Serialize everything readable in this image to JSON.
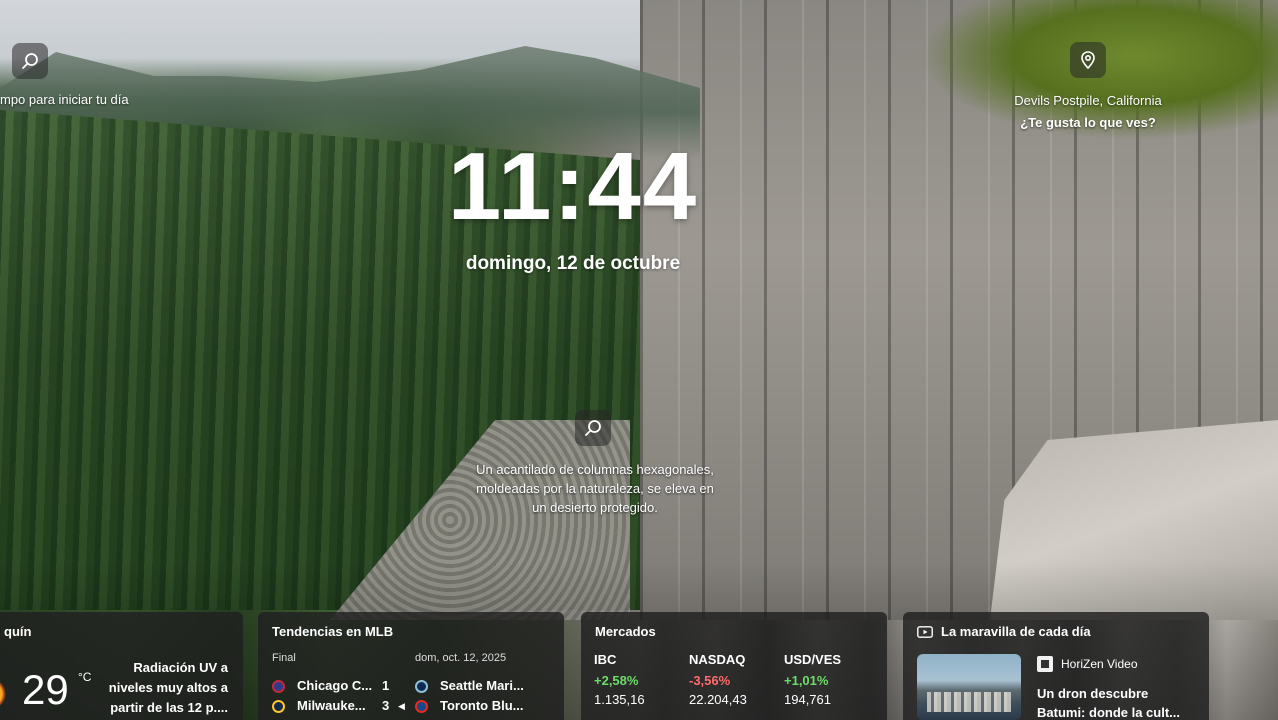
{
  "lock_screen": {
    "time": "11:44",
    "date": "domingo, 12 de octubre",
    "top_left_text": "mpo para iniciar tu día",
    "location": "Devils Postpile, California",
    "like_prompt": "¿Te gusta lo que ves?",
    "caption_lines": [
      "Un acantilado de columnas hexagonales,",
      "moldeadas por la naturaleza, se eleva en",
      "un desierto protegido."
    ]
  },
  "icons": {
    "top_left": "search-icon",
    "location": "location-pin-icon",
    "center": "search-icon"
  },
  "widgets": {
    "weather": {
      "title": "quín",
      "temp": "29",
      "unit": "°C",
      "desc_lines": [
        "Radiación UV a",
        "niveles muy altos a",
        "partir de las 12 p...."
      ]
    },
    "mlb": {
      "title": "Tendencias en MLB",
      "status": "Final",
      "date": "dom, oct. 12, 2025",
      "games": [
        {
          "team1": "Chicago C...",
          "score": "1",
          "team2": "Seattle Mari..."
        },
        {
          "team1": "Milwauke...",
          "score": "3",
          "team2": "Toronto Blu..."
        }
      ]
    },
    "markets": {
      "title": "Mercados",
      "items": [
        {
          "name": "IBC",
          "change": "+2,58%",
          "value": "1.135,16",
          "direction": "up"
        },
        {
          "name": "NASDAQ",
          "change": "-3,56%",
          "value": "22.204,43",
          "direction": "down"
        },
        {
          "name": "USD/VES",
          "change": "+1,01%",
          "value": "194,761",
          "direction": "up"
        }
      ]
    },
    "wonder": {
      "title": "La maravilla de cada día",
      "source": "HoriZen Video",
      "headline_lines": [
        "Un dron descubre",
        "Batumi: donde la cult..."
      ]
    }
  },
  "colors": {
    "positive": "#6ddc6a",
    "negative": "#ff6b6b",
    "widget_bg": "rgba(32,32,32,.82)"
  }
}
